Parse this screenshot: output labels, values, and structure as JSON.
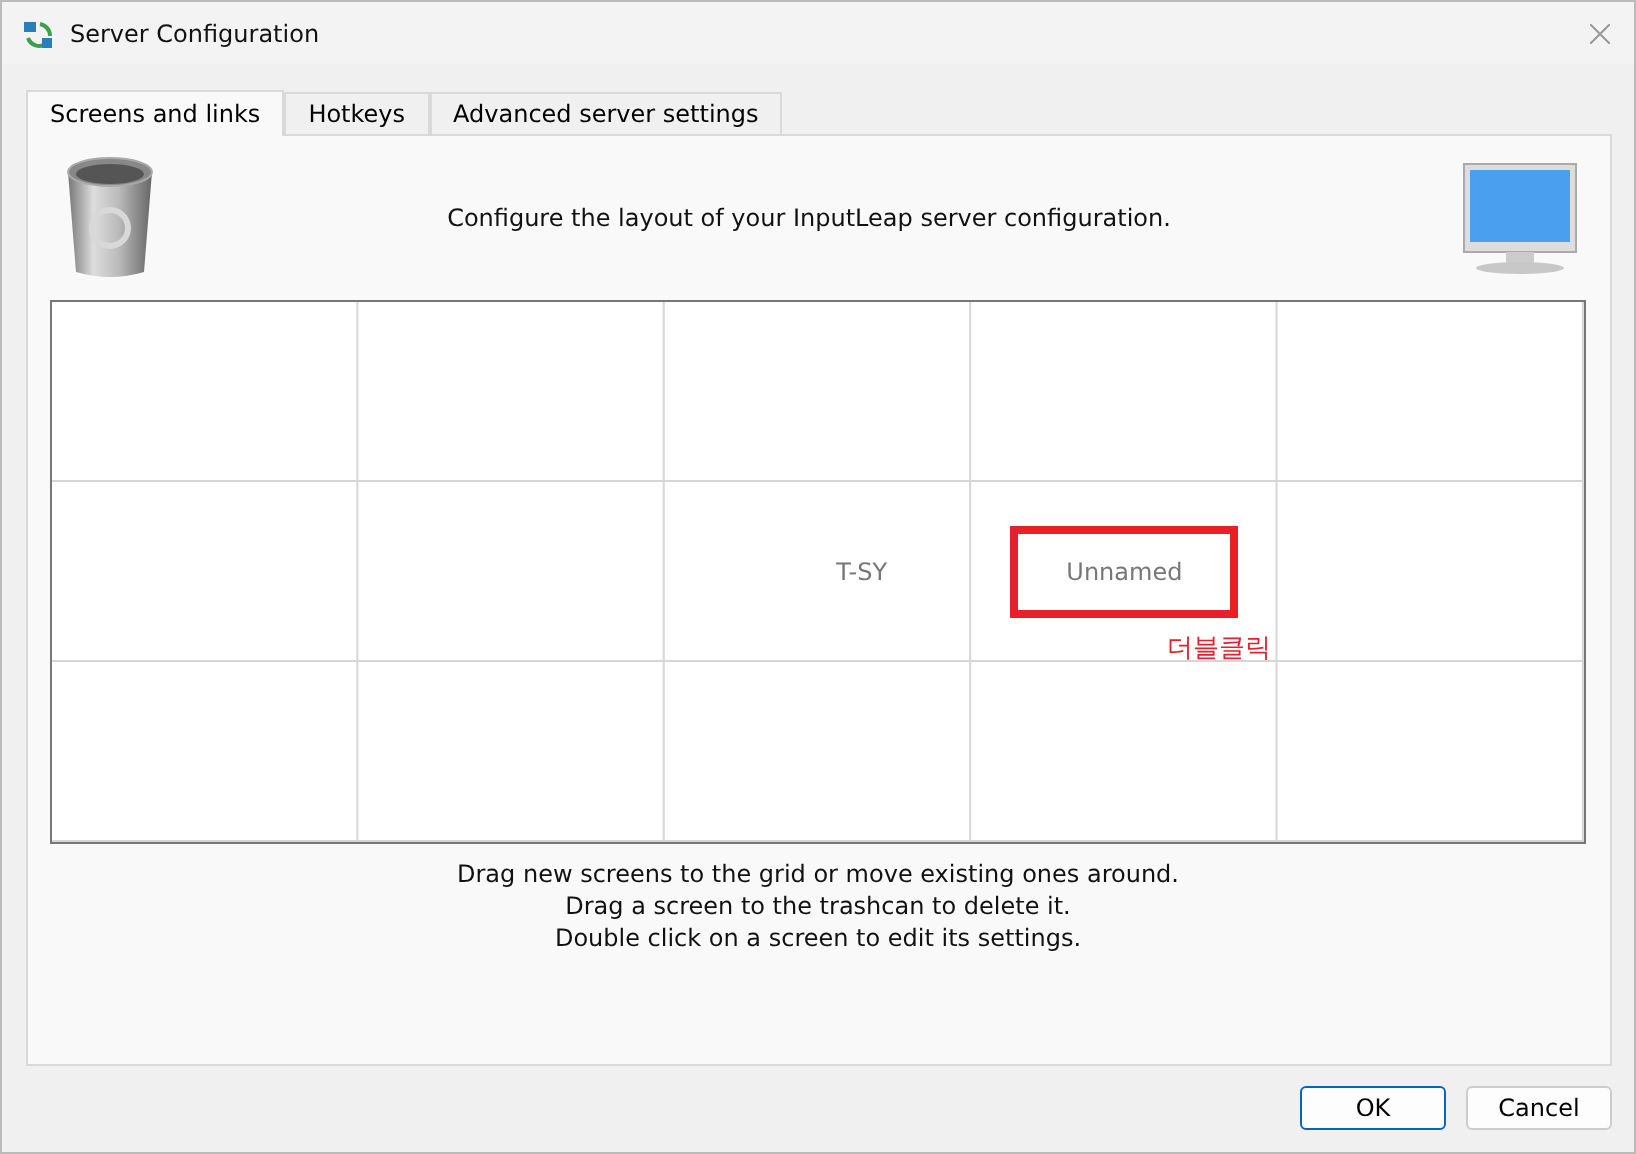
{
  "window": {
    "title": "Server Configuration"
  },
  "tabs": [
    {
      "label": "Screens and links",
      "selected": true
    },
    {
      "label": "Hotkeys",
      "selected": false
    },
    {
      "label": "Advanced server settings",
      "selected": false
    }
  ],
  "heading": "Configure the layout of your InputLeap server configuration.",
  "grid": {
    "rows": [
      [
        {},
        {},
        {},
        {},
        {}
      ],
      [
        {},
        {},
        {
          "screen": "T-SY",
          "cut": true,
          "highlighted": false
        },
        {
          "screen": "Unnamed",
          "cut": false,
          "highlighted": true,
          "annotation": "더블클릭"
        },
        {}
      ],
      [
        {},
        {},
        {},
        {},
        {}
      ]
    ]
  },
  "hints": [
    "Drag new screens to the grid or move existing ones around.",
    "Drag a screen to the trashcan to delete it.",
    "Double click on a screen to edit its settings."
  ],
  "buttons": [
    {
      "label": "OK",
      "default": true
    },
    {
      "label": "Cancel",
      "default": false
    }
  ]
}
